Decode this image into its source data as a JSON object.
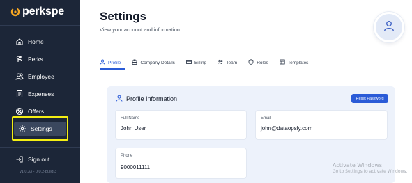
{
  "sidebar": {
    "logo_text": "perkspe",
    "items": [
      {
        "label": "Home",
        "icon": "home-icon"
      },
      {
        "label": "Perks",
        "icon": "perks-icon"
      },
      {
        "label": "Employee",
        "icon": "users-icon"
      },
      {
        "label": "Expenses",
        "icon": "receipt-icon"
      },
      {
        "label": "Offers",
        "icon": "offer-icon"
      },
      {
        "label": "Settings",
        "icon": "gear-icon",
        "active": true
      }
    ],
    "signout_label": "Sign out",
    "version": "v1.0.33 - 0.0.2-build.3"
  },
  "header": {
    "title": "Settings",
    "subtitle": "View your account and information"
  },
  "tabs": [
    {
      "label": "Profile",
      "icon": "user-icon",
      "active": true
    },
    {
      "label": "Company Details",
      "icon": "building-icon"
    },
    {
      "label": "Billing",
      "icon": "card-icon"
    },
    {
      "label": "Team",
      "icon": "team-icon"
    },
    {
      "label": "Roles",
      "icon": "shield-icon"
    },
    {
      "label": "Templates",
      "icon": "template-icon"
    }
  ],
  "profile": {
    "section_title": "Profile Information",
    "reset_button": "Reset Password",
    "fields": {
      "full_name": {
        "label": "Full Name",
        "value": "John User"
      },
      "email": {
        "label": "Email",
        "value": "john@dataopsly.com"
      },
      "phone": {
        "label": "Phone",
        "value": "9000011111"
      }
    }
  },
  "watermark": {
    "line1": "Activate Windows",
    "line2": "Go to Settings to activate Windows."
  },
  "colors": {
    "sidebar_bg": "#1c2638",
    "accent": "#2a5bd7",
    "highlight": "#f4ee13",
    "panel_bg": "#edf2fb"
  }
}
